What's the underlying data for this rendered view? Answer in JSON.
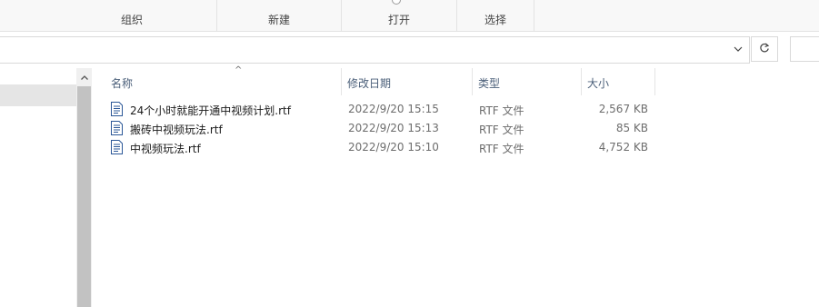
{
  "ribbon": {
    "groups": [
      {
        "label": "组织"
      },
      {
        "label": "新建"
      },
      {
        "label": "打开"
      },
      {
        "label": "选择"
      }
    ]
  },
  "address_bar": {
    "path": "",
    "chevron_icon": "chevron-down-icon",
    "refresh_icon": "refresh-icon"
  },
  "file_list": {
    "columns": [
      {
        "label": "名称"
      },
      {
        "label": "修改日期"
      },
      {
        "label": "类型"
      },
      {
        "label": "大小"
      }
    ],
    "sort_indicator": "^",
    "rows": [
      {
        "name": "24个小时就能开通中视频计划.rtf",
        "modified": "2022/9/20 15:15",
        "type": "RTF 文件",
        "size": "2,567 KB"
      },
      {
        "name": "搬砖中视频玩法.rtf",
        "modified": "2022/9/20 15:13",
        "type": "RTF 文件",
        "size": "85 KB"
      },
      {
        "name": "中视频玩法.rtf",
        "modified": "2022/9/20 15:10",
        "type": "RTF 文件",
        "size": "4,752 KB"
      }
    ]
  },
  "colors": {
    "header_text": "#4c607a",
    "selected_nav": "#e5e5e5",
    "scrollbar_thumb": "#c2c2c2",
    "file_icon": "#2b5797"
  }
}
